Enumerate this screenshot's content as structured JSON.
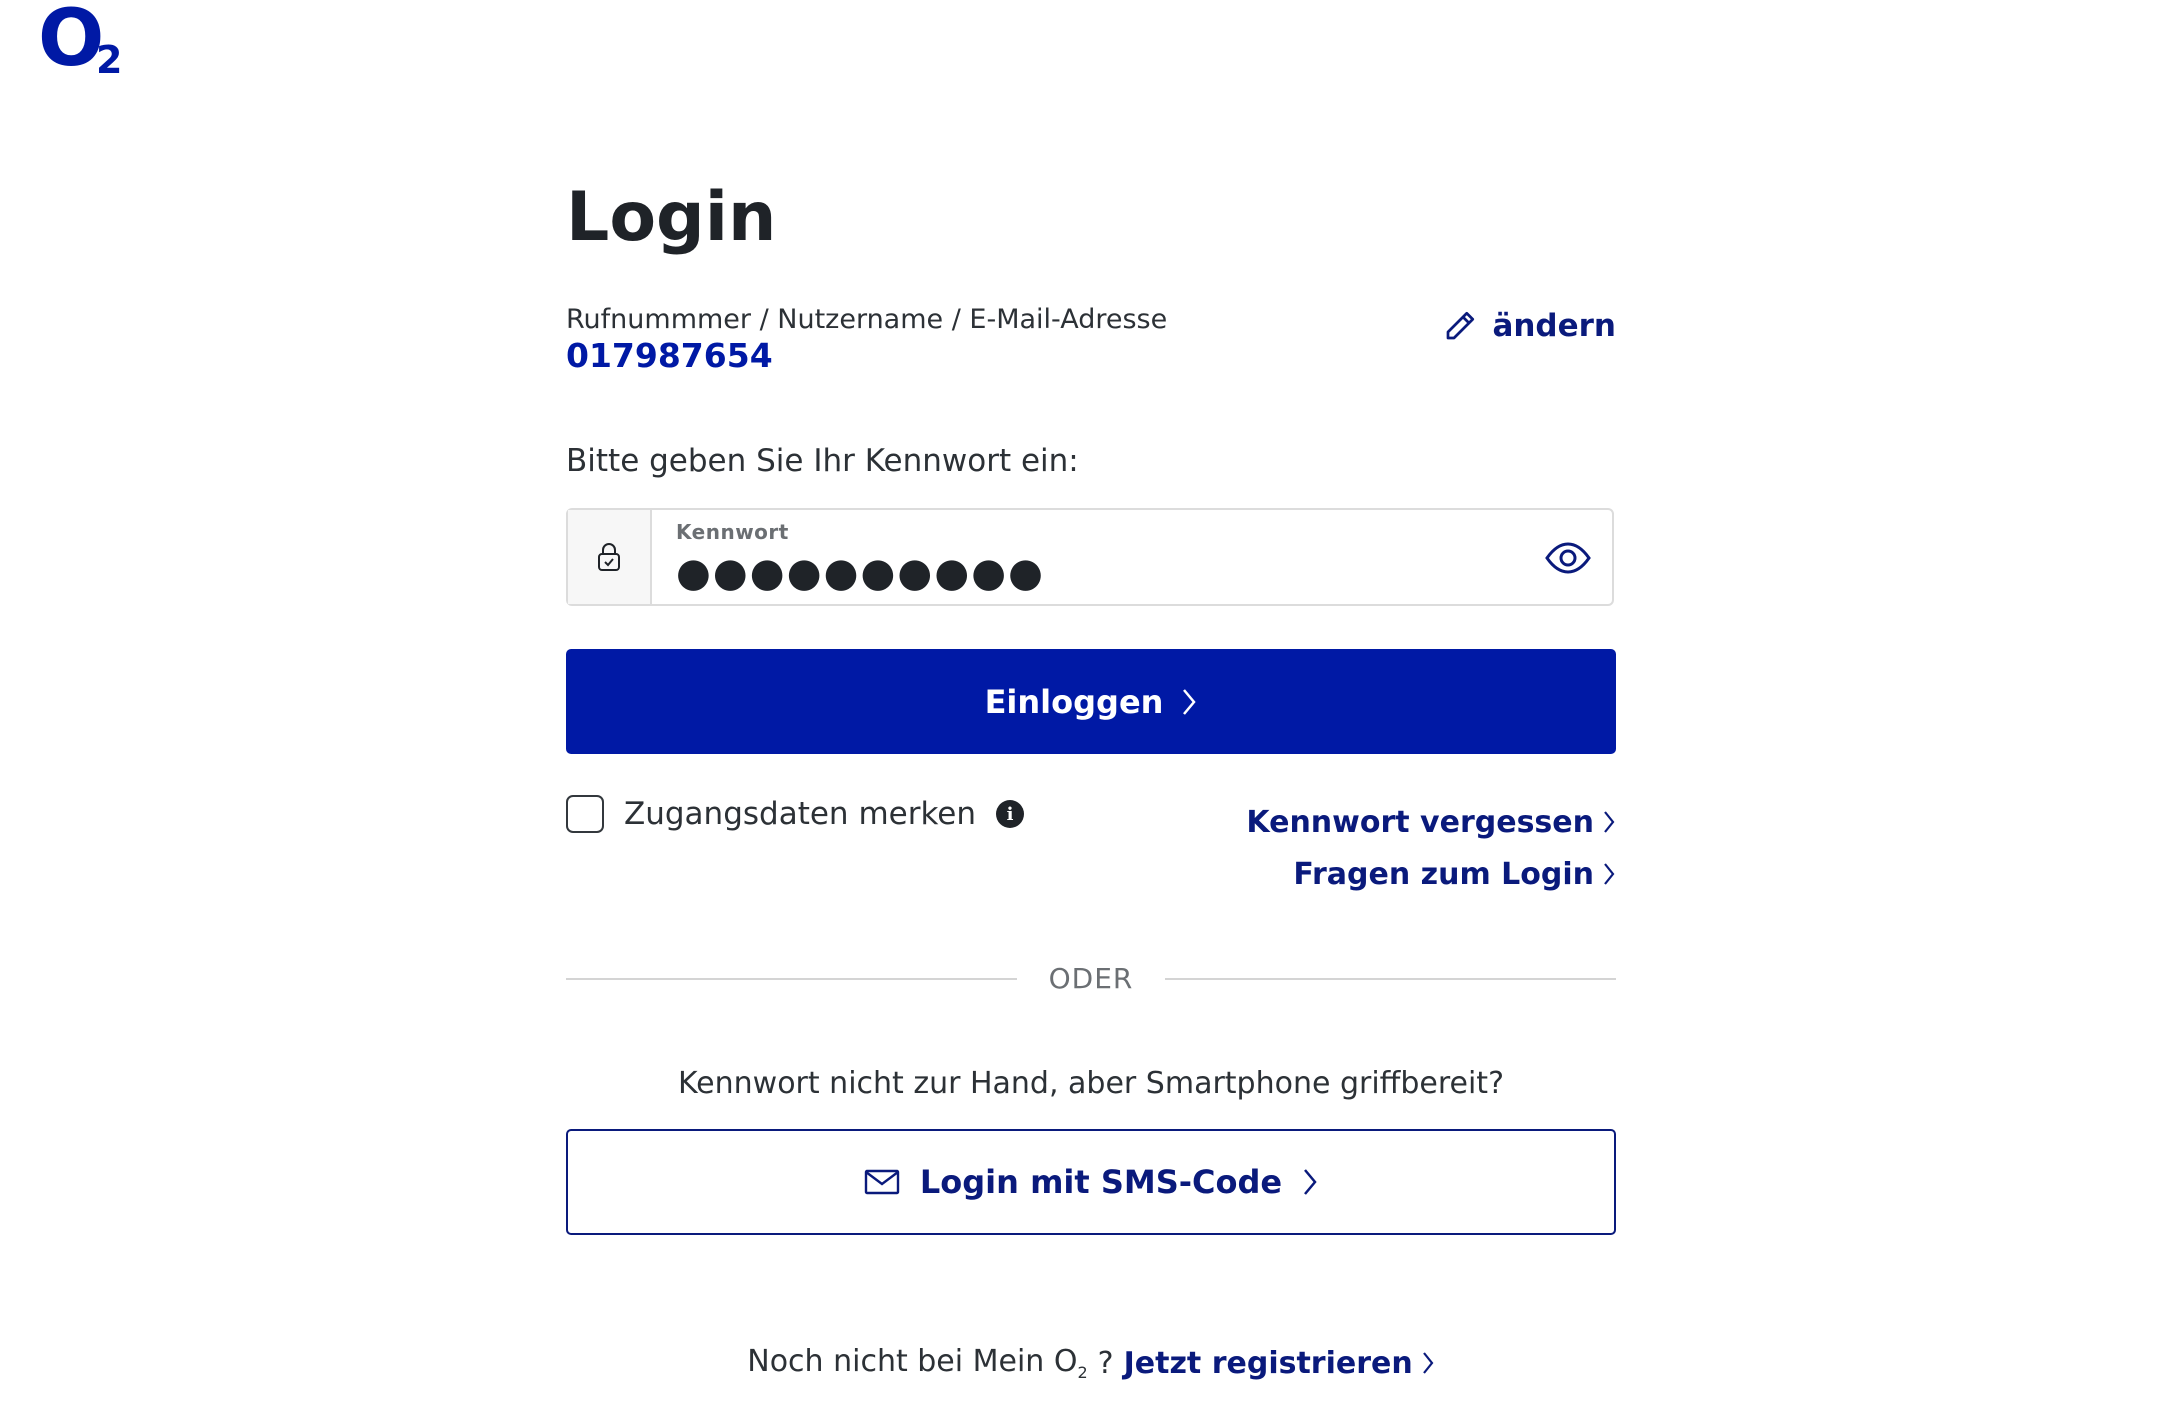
{
  "logo": {
    "text": "O",
    "sub": "2"
  },
  "page": {
    "title": "Login"
  },
  "account": {
    "label": "Rufnummmer / Nutzername / E-Mail-Adresse",
    "value": "017987654",
    "change_label": "ändern"
  },
  "password": {
    "prompt": "Bitte geben Sie Ihr Kennwort ein:",
    "label": "Kennwort",
    "value": "●●●●●●●●●●"
  },
  "login_button": {
    "label": "Einloggen"
  },
  "remember": {
    "label": "Zugangsdaten merken",
    "info": "i",
    "checked": false
  },
  "links": {
    "forgot": "Kennwort vergessen",
    "faq": "Fragen zum Login"
  },
  "divider": {
    "label": "ODER"
  },
  "sms": {
    "prompt": "Kennwort nicht zur Hand, aber Smartphone griffbereit?",
    "button_label": "Login mit SMS-Code"
  },
  "register": {
    "text_before": "Noch nicht bei Mein O",
    "sub": "2",
    "text_after": "?",
    "link": "Jetzt registrieren"
  },
  "colors": {
    "brand": "#0019a5",
    "link": "#0a1a7c",
    "text": "#2c3136"
  }
}
